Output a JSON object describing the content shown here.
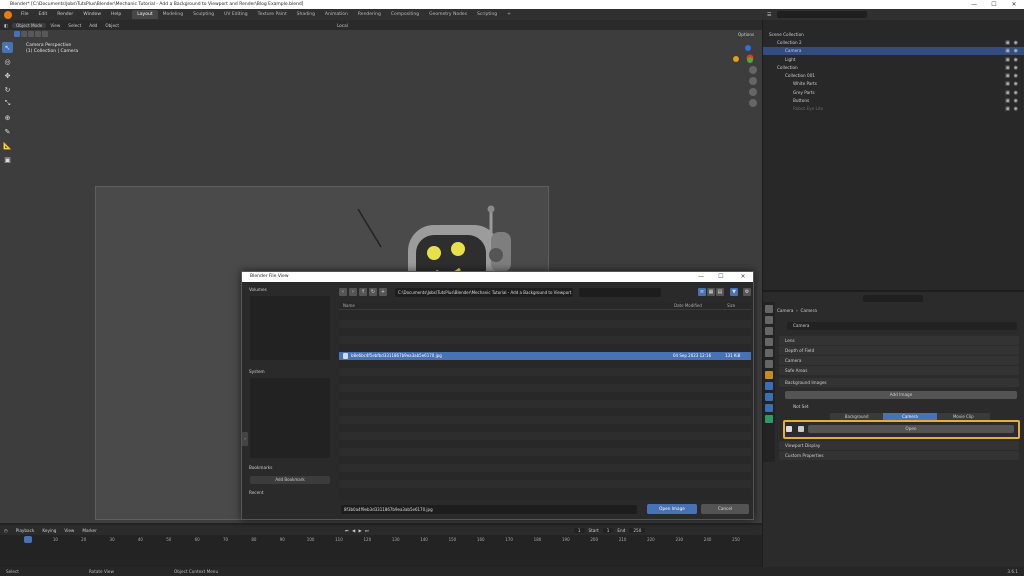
{
  "window": {
    "title": "Blender* [C:\\Documents\\Jobs\\TutsPlus\\Blender\\Mechanic Tutorial - Add a Background to Viewport and Render\\Blog Example.blend]",
    "minimize": "—",
    "maximize": "☐",
    "close": "✕"
  },
  "menu": [
    "File",
    "Edit",
    "Render",
    "Window",
    "Help"
  ],
  "workspaces": [
    "Layout",
    "Modeling",
    "Sculpting",
    "UV Editing",
    "Texture Paint",
    "Shading",
    "Animation",
    "Rendering",
    "Compositing",
    "Geometry Nodes",
    "Scripting"
  ],
  "workspace_add": "+",
  "scene": {
    "scene_name": "Scene",
    "view_layer": "ViewLayer"
  },
  "viewport": {
    "mode": "Object Mode",
    "menus": [
      "View",
      "Select",
      "Add",
      "Object"
    ],
    "orientation": "Local",
    "options_label": "Options",
    "camera_label_1": "Camera Perspective",
    "camera_label_2": "(1) Collection | Camera"
  },
  "outliner": {
    "search_placeholder": "",
    "rows": [
      {
        "label": "Scene Collection",
        "indent": 0
      },
      {
        "label": "Collection 2",
        "indent": 1
      },
      {
        "label": "Camera",
        "indent": 2,
        "selected": true
      },
      {
        "label": "Light",
        "indent": 2
      },
      {
        "label": "Collection",
        "indent": 1
      },
      {
        "label": "Collection 001",
        "indent": 2
      },
      {
        "label": "White Parts",
        "indent": 3
      },
      {
        "label": "Grey Parts",
        "indent": 3
      },
      {
        "label": "Buttons",
        "indent": 3
      },
      {
        "label": "Robot Eye Lite",
        "indent": 3,
        "dim": true
      }
    ]
  },
  "properties": {
    "breadcrumb_object": "Camera",
    "breadcrumb_data": "Camera",
    "data_name": "Camera",
    "sections": [
      "Lens",
      "Depth of Field",
      "Camera",
      "Safe Areas",
      "Background Images"
    ],
    "add_image": "Add Image",
    "image_panel": "Not Set",
    "source_tabs": [
      "Background",
      "Camera",
      "Movie Clip"
    ],
    "open_label": "Open",
    "more_sections": [
      "Viewport Display",
      "Custom Properties"
    ]
  },
  "timeline": {
    "menus": [
      "Playback",
      "Keying",
      "View",
      "Marker"
    ],
    "current_frame": "1",
    "start_label": "Start",
    "start": "1",
    "end_label": "End",
    "end": "250",
    "ticks": [
      "0",
      "10",
      "20",
      "30",
      "40",
      "50",
      "60",
      "70",
      "80",
      "90",
      "100",
      "110",
      "120",
      "130",
      "140",
      "150",
      "160",
      "170",
      "180",
      "190",
      "200",
      "210",
      "220",
      "230",
      "240",
      "250"
    ]
  },
  "status": {
    "select": "Select",
    "rotate": "Rotate View",
    "context": "Object Context Menu",
    "version": "3.6.1"
  },
  "dialog": {
    "title": "Blender File View",
    "min": "—",
    "max": "☐",
    "close": "✕",
    "side_sections": [
      "Volumes",
      "System",
      "Bookmarks",
      "Recent"
    ],
    "add_bookmark": "Add Bookmark",
    "path": "C:\\Documents\\Jobs\\TutsPlus\\Blender\\Mechanic Tutorial - Add a Background to Viewport and Render\\",
    "search_placeholder": "",
    "columns": {
      "name": "Name",
      "date": "Date Modified",
      "size": "Size"
    },
    "files": [
      {
        "name": "b8e6bc4f5ebfbd3311867b9ea3ab5e6170.jpg",
        "date": "04 Sep 2023 12:16",
        "size": "131 KiB",
        "selected": true
      }
    ],
    "filename": "8f3b0a4f9eb3d3311867b9ea3ab5e6170.jpg",
    "open_button": "Open Image",
    "cancel_button": "Cancel"
  },
  "colors": {
    "accent": "#4772b3",
    "highlight": "#e8b030",
    "robot_eye": "#e8e04a"
  }
}
